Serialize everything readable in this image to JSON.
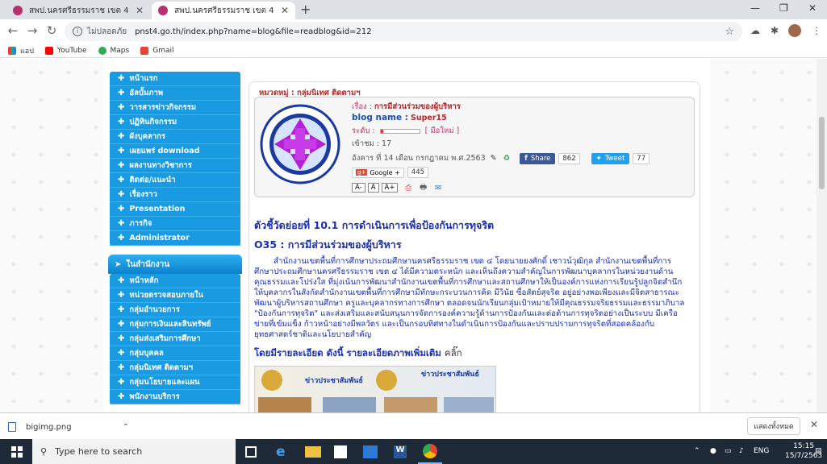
{
  "browser": {
    "tabs": [
      {
        "title": "สพป.นครศรีธรรมราช เขต 4",
        "active": false
      },
      {
        "title": "สพป.นครศรีธรรมราช เขต 4",
        "active": true
      }
    ],
    "address": {
      "security_label": "ไม่ปลอดภัย",
      "url": "pnst4.go.th/index.php?name=blog&file=readblog&id=212"
    },
    "bookmarks": [
      {
        "label": "แอป",
        "icon": "apps-grid-icon"
      },
      {
        "label": "YouTube",
        "icon": "youtube-icon"
      },
      {
        "label": "Maps",
        "icon": "maps-icon"
      },
      {
        "label": "Gmail",
        "icon": "gmail-icon"
      }
    ]
  },
  "sidebar": {
    "menu1": [
      {
        "label": "หน้าแรก"
      },
      {
        "label": "อัลบั้มภาพ"
      },
      {
        "label": "วารสารข่าวกิจกรรม"
      },
      {
        "label": "ปฏิทินกิจกรรม"
      },
      {
        "label": "ผังบุคลากร"
      },
      {
        "label": "เผยแพร่ download"
      },
      {
        "label": "ผลงานทางวิชาการ"
      },
      {
        "label": "ติดต่อ/แนะนำ"
      },
      {
        "label": "เรื่องราว"
      },
      {
        "label": "Presentation"
      },
      {
        "label": "ภารกิจ"
      },
      {
        "label": "Administrator"
      }
    ],
    "section2_title": "ในสำนักงาน",
    "menu2": [
      {
        "label": "หน้าหลัก"
      },
      {
        "label": "หน่วยตรวจสอบภายใน"
      },
      {
        "label": "กลุ่มอำนวยการ"
      },
      {
        "label": "กลุ่มการเงินและสินทรัพย์"
      },
      {
        "label": "กลุ่มส่งเสริมการศึกษา"
      },
      {
        "label": "กลุ่มบุคคล"
      },
      {
        "label": "กลุ่มนิเทศ ติดตามฯ"
      },
      {
        "label": "กลุ่มนโยบายและแผน"
      },
      {
        "label": "พนักงานบริการ"
      }
    ]
  },
  "article": {
    "category_label": "หมวดหมู่ :",
    "category_value": "กลุ่มนิเทศ ติดตามฯ",
    "subject_label": "เรื่อง :",
    "subject_value": "การมีส่วนร่วมของผู้บริหาร",
    "blog_name_label": "blog name :",
    "blog_name_value": "Super15",
    "level_label": "ระดับ :",
    "level_value": "[ มือใหม่ ]",
    "views": "เข้าชม : 17",
    "date": "อังคาร ที่ 14 เดือน กรกฎาคม พ.ศ.2563",
    "share_label": "Share",
    "share_count": "862",
    "tweet_label": "Tweet",
    "tweet_count": "77",
    "gplus_label": "Google +",
    "gplus_count": "445",
    "font_buttons": [
      "A-",
      "A",
      "A+"
    ],
    "heading1": "ตัวชี้วัดย่อยที่ 10.1 การดำเนินการเพื่อป้องกันการทุจริต",
    "heading2": "O35 : การมีส่วนร่วมของผู้บริหาร",
    "body": "สำนักงานเขตพื้นที่การศึกษาประถมศึกษานครศรีธรรมราช เขต ๔ โดยนายยงศักดิ์ เชาวน์วุฒิกุล สำนักงานเขตพื้นที่การศึกษาประถมศึกษานครศรีธรรมราช เขต ๔ ได้มีความตระหนัก และเห็นถึงความสำคัญในการพัฒนาบุคลากรในหน่วยงานด้านคุณธรรมและโปร่งใส ที่มุ่งเน้นการพัฒนาสำนักงานเขตพื้นที่การศึกษาและสถานศึกษาให้เป็นองค์การแห่งการเรียนรู้ปลูกจิตสำนึกให้บุคลากรในสังกัดสำนักงานเขตพื้นที่การศึกษามีทักษะกระบวนการคิด มีวินัย ซื่อสัตย์สุจริต อยู่อย่างพอเพียงและมีจิตสาธารณะ พัฒนาผู้บริหารสถานศึกษา ครูและบุคลากรทางการศึกษา ตลอดจนนักเรียนกลุ่มเป้าหมายให้มีคุณธรรมจริยธรรมและธรรมาภิบาล \"ป้องกันการทุจริต\" และส่งเสริมและสนับสนุนการจัดการองค์ความรู้ด้านการป้องกันและต่อต้านการทุจริตอย่างเป็นระบบ มีเครือข่ายที่เข้มแข็ง ก้าวหน้าอย่างมีพลวัตร และเป็นกรอบทิศทางในดำเนินการป้องกันและปราบปรามการทุจริตที่สอดคล้องกับยุทธศาสตร์ชาติและนโยบายสำคัญ",
    "detail_text": "โดยมีรายละเอียด ดังนี้ รายละเอียดภาพเพิ่มเติม",
    "detail_link": "คลิ๊ก",
    "banner_text1": "ข่าวประชาสัมพันธ์",
    "banner_text2": "ข่าวประชาสัมพันธ์"
  },
  "downloads": {
    "file_name": "bigimg.png",
    "show_all": "แสดงทั้งหมด"
  },
  "taskbar": {
    "search_placeholder": "Type here to search",
    "lang": "ENG",
    "time": "15:15",
    "date": "15/7/2563"
  },
  "colors": {
    "sidebar_blue": "#1a9ae0",
    "heading_blue": "#1a2faf",
    "label_red": "#c0306a",
    "facebook": "#3b5998",
    "twitter": "#1da1f2"
  }
}
